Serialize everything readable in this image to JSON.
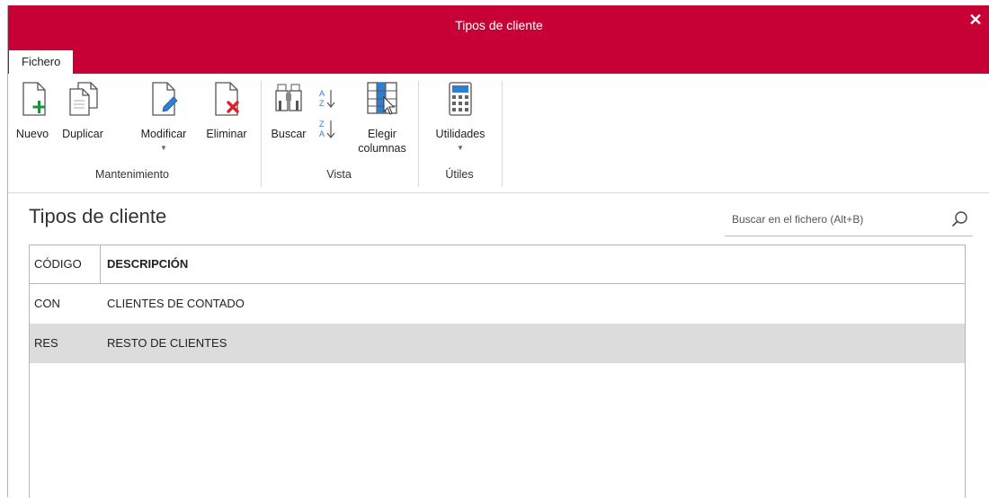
{
  "window": {
    "title": "Tipos de cliente",
    "close_label": "✕"
  },
  "tabs": [
    {
      "label": "Fichero"
    }
  ],
  "ribbon": {
    "groups": [
      {
        "label": "Mantenimiento",
        "buttons": [
          {
            "label": "Nuevo",
            "icon": "new-document-icon"
          },
          {
            "label": "Duplicar",
            "icon": "duplicate-icon"
          },
          {
            "label": "Modificar",
            "icon": "edit-document-icon",
            "has_dropdown": true
          },
          {
            "label": "Eliminar",
            "icon": "delete-document-icon"
          }
        ]
      },
      {
        "label": "Vista",
        "buttons": [
          {
            "label": "Buscar",
            "icon": "binoculars-icon"
          },
          {
            "label": "",
            "icon": "sort-az-icon"
          },
          {
            "label": "",
            "icon": "sort-za-icon"
          },
          {
            "label": "Elegir\ncolumnas",
            "icon": "choose-columns-icon"
          }
        ]
      },
      {
        "label": "Útiles",
        "buttons": [
          {
            "label": "Utilidades",
            "icon": "calculator-icon",
            "has_dropdown": true
          }
        ]
      }
    ]
  },
  "page": {
    "title": "Tipos de cliente"
  },
  "search": {
    "placeholder": "Buscar en el fichero (Alt+B)",
    "value": ""
  },
  "table": {
    "columns": [
      "CÓDIGO",
      "DESCRIPCIÓN"
    ],
    "rows": [
      {
        "codigo": "CON",
        "descripcion": "CLIENTES DE CONTADO",
        "selected": false
      },
      {
        "codigo": "RES",
        "descripcion": "RESTO DE CLIENTES",
        "selected": true
      }
    ]
  },
  "colors": {
    "accent": "#c70036",
    "selected_row": "#dcdcdc",
    "icon_green": "#1e8f3c",
    "icon_red": "#e0202a",
    "icon_blue": "#2f7fd0"
  }
}
